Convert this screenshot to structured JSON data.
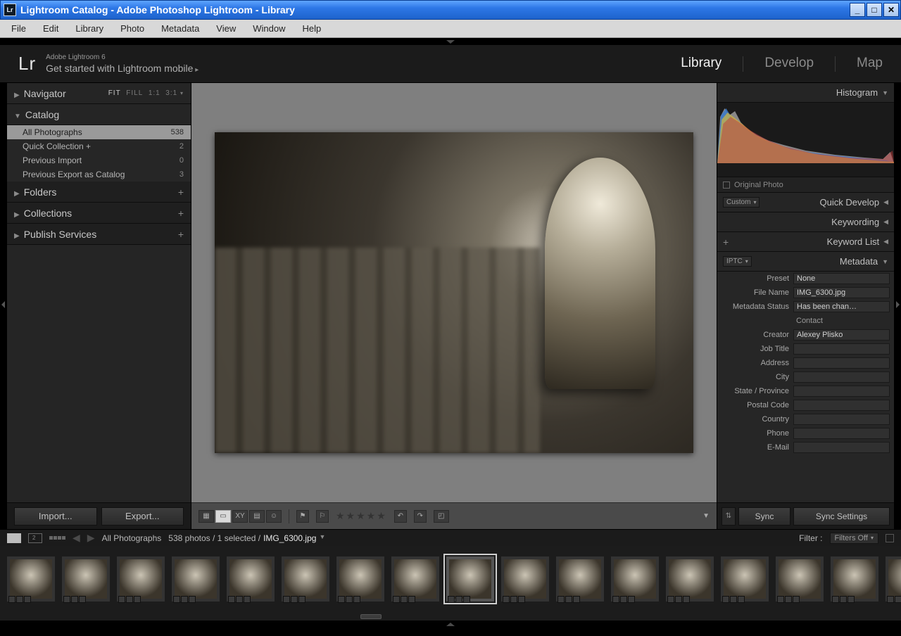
{
  "window": {
    "title": "Lightroom Catalog - Adobe Photoshop Lightroom - Library"
  },
  "menu": [
    "File",
    "Edit",
    "Library",
    "Photo",
    "Metadata",
    "View",
    "Window",
    "Help"
  ],
  "identity": {
    "logo": "Lr",
    "line1": "Adobe Lightroom 6",
    "line2": "Get started with Lightroom mobile"
  },
  "modules": {
    "items": [
      "Library",
      "Develop",
      "Map"
    ],
    "active": "Library"
  },
  "left": {
    "navigator": {
      "title": "Navigator",
      "modes": {
        "fit": "FIT",
        "fill": "FILL",
        "one": "1:1",
        "three": "3:1"
      }
    },
    "catalog": {
      "title": "Catalog",
      "rows": [
        {
          "label": "All Photographs",
          "count": "538",
          "selected": true
        },
        {
          "label": "Quick Collection  +",
          "count": "2"
        },
        {
          "label": "Previous Import",
          "count": "0"
        },
        {
          "label": "Previous Export as Catalog",
          "count": "3"
        }
      ]
    },
    "sections": [
      "Folders",
      "Collections",
      "Publish Services"
    ],
    "buttons": {
      "import": "Import...",
      "export": "Export..."
    }
  },
  "right": {
    "histogram": {
      "title": "Histogram",
      "original": "Original Photo"
    },
    "quick_develop": {
      "title": "Quick Develop",
      "preset": "Custom"
    },
    "keywording": {
      "title": "Keywording"
    },
    "keyword_list": {
      "title": "Keyword List"
    },
    "metadata": {
      "title": "Metadata",
      "mode": "IPTC",
      "preset_label": "Preset",
      "preset": "None",
      "rows": [
        {
          "label": "File Name",
          "value": "IMG_6300.jpg"
        },
        {
          "label": "Metadata Status",
          "value": "Has been chan…"
        }
      ],
      "section": "Contact",
      "contact": [
        {
          "label": "Creator",
          "value": "Alexey Plisko"
        },
        {
          "label": "Job Title",
          "value": ""
        },
        {
          "label": "Address",
          "value": ""
        },
        {
          "label": "City",
          "value": ""
        },
        {
          "label": "State / Province",
          "value": ""
        },
        {
          "label": "Postal Code",
          "value": ""
        },
        {
          "label": "Country",
          "value": ""
        },
        {
          "label": "Phone",
          "value": ""
        },
        {
          "label": "E-Mail",
          "value": ""
        }
      ]
    },
    "buttons": {
      "sync": "Sync",
      "sync_settings": "Sync Settings"
    }
  },
  "filmstrip": {
    "source": "All Photographs",
    "summary": "538 photos / 1 selected /",
    "file": "IMG_6300.jpg",
    "filter_label": "Filter :",
    "filter": "Filters Off",
    "selected_index": 8
  }
}
